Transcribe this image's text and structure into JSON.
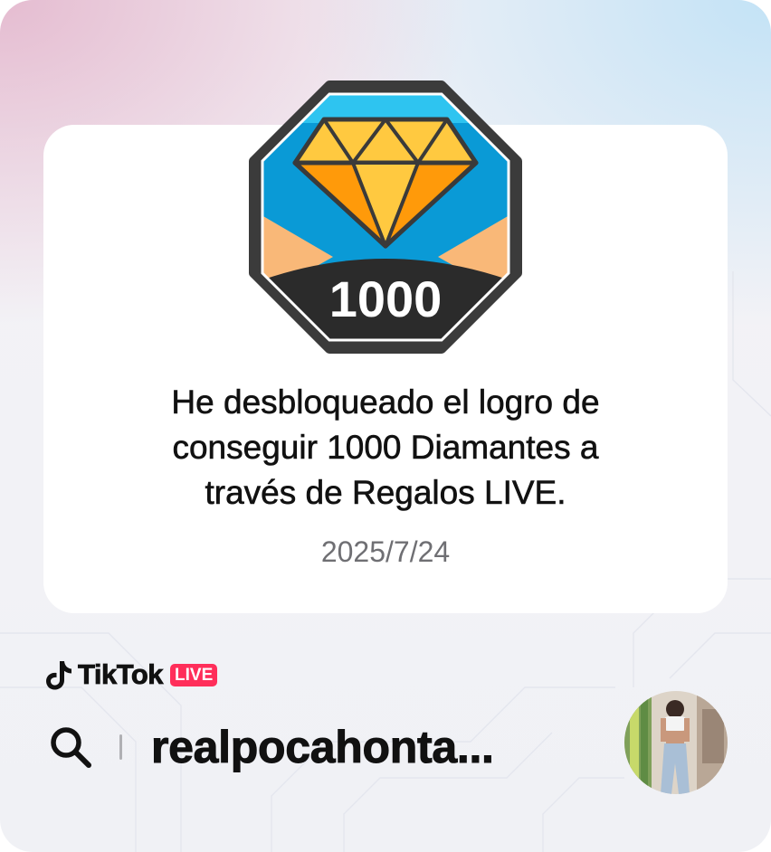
{
  "badge": {
    "number": "1000",
    "icon": "diamond-icon"
  },
  "achievement": {
    "message_lines": [
      "He desbloqueado el logro de",
      "conseguir 1000 Diamantes a",
      "través de Regalos LIVE."
    ],
    "date": "2025/7/24"
  },
  "brand": {
    "name": "TikTok",
    "live_label": "LIVE",
    "logo_icon": "tiktok-note-icon"
  },
  "search": {
    "username": "realpocahonta...",
    "icon": "search-icon"
  },
  "profile": {
    "avatar": "profile-avatar"
  },
  "colors": {
    "badge_blue": "#0a9ad6",
    "badge_top_blue": "#2ec4f0",
    "badge_peach": "#f9b878",
    "badge_dark": "#2b2b2b",
    "diamond_yellow": "#ffc940",
    "diamond_orange": "#ff9a0a",
    "live_red": "#ff2e5a",
    "date_gray": "#6f6f73"
  }
}
